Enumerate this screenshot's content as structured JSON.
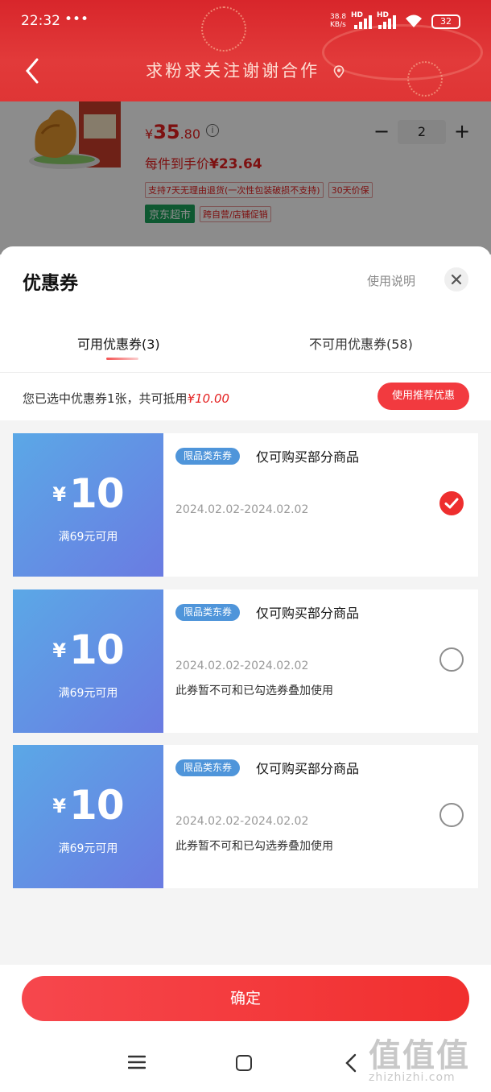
{
  "status_bar": {
    "time": "22:32",
    "dots": "•••",
    "net_speed": "38.8",
    "net_unit": "KB/s",
    "hd1": "HD",
    "hd2": "HD",
    "battery": "32"
  },
  "header": {
    "title": "求粉求关注谢谢合作"
  },
  "product": {
    "price_symbol": "¥",
    "price_int": "35",
    "price_dec": ".80",
    "info": "i",
    "quantity": "2",
    "minus": "−",
    "plus": "+",
    "unit_price_label": "每件到手价",
    "unit_price": "¥23.64",
    "tags": [
      "支持7天无理由退货(一次性包装破损不支持)",
      "30天价保"
    ],
    "store_badge": "京东超市",
    "promo_tag": "跨自营/店铺促销"
  },
  "sheet": {
    "title": "优惠券",
    "usage_link": "使用说明",
    "tabs": [
      {
        "label": "可用优惠券(3)"
      },
      {
        "label": "不可用优惠券(58)"
      }
    ],
    "summary_prefix": "您已选中优惠券1张，共可抵用",
    "summary_amount": "¥10.00",
    "recommend_button": "使用推荐优惠",
    "coupons": [
      {
        "symbol": "¥",
        "amount": "10",
        "condition": "满69元可用",
        "badge": "限品类东券",
        "desc": "仅可购买部分商品",
        "date": "2024.02.02-2024.02.02",
        "note": "",
        "selected": true
      },
      {
        "symbol": "¥",
        "amount": "10",
        "condition": "满69元可用",
        "badge": "限品类东券",
        "desc": "仅可购买部分商品",
        "date": "2024.02.02-2024.02.02",
        "note": "此券暂不可和已勾选券叠加使用",
        "selected": false
      },
      {
        "symbol": "¥",
        "amount": "10",
        "condition": "满69元可用",
        "badge": "限品类东券",
        "desc": "仅可购买部分商品",
        "date": "2024.02.02-2024.02.02",
        "note": "此券暂不可和已勾选券叠加使用",
        "selected": false
      }
    ],
    "confirm_button": "确定"
  },
  "watermark": {
    "big": "值值值",
    "small": "zhizhizhi.com"
  },
  "colors": {
    "accent_red": "#f23a3f",
    "coupon_blue": "#5ba8e6",
    "header_red": "#d8262b"
  }
}
